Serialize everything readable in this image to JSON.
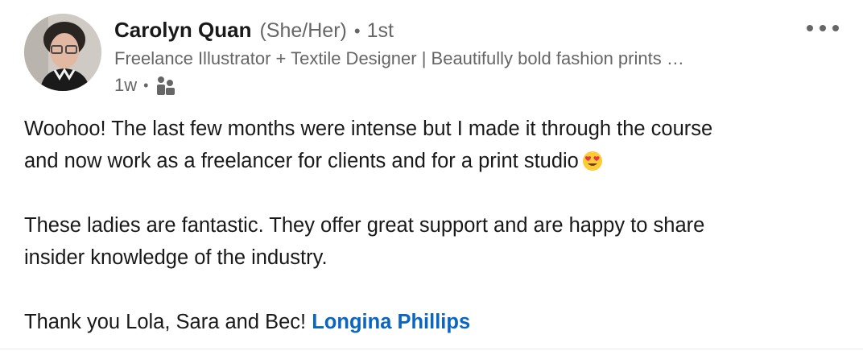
{
  "author": {
    "name": "Carolyn Quan",
    "pronouns": "(She/Her)",
    "separator": "•",
    "connection_degree": "1st",
    "headline": "Freelance Illustrator + Textile Designer | Beautifully bold fashion prints …",
    "avatar_icon": "profile-photo"
  },
  "meta": {
    "time_ago": "1w",
    "separator": "•",
    "audience_icon": "connections-only-icon"
  },
  "menu": {
    "more_icon": "ellipsis-icon"
  },
  "post": {
    "line1": "Woohoo! The last few months were intense but I made it through the course",
    "line2": "and now work as a freelancer for clients and for a print studio",
    "emoji": "heart-eyes-emoji",
    "line3": "These ladies are fantastic. They offer great support and are happy to share",
    "line4": "insider knowledge of the industry.",
    "line5_text": "Thank you Lola, Sara and Bec!",
    "mention": "Longina Phillips"
  },
  "colors": {
    "link": "#0a66c2",
    "text": "#191919",
    "muted": "#666666"
  }
}
